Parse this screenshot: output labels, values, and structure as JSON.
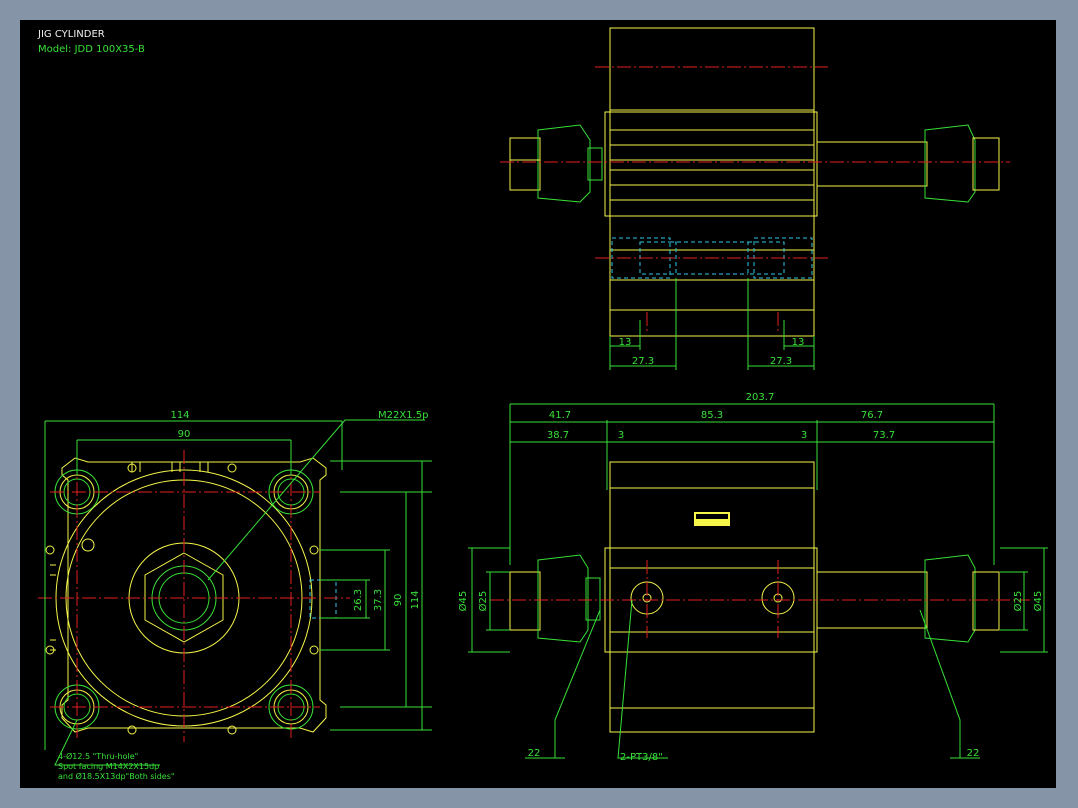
{
  "title": {
    "line1": "JIG CYLINDER",
    "line2": "Model: JDD 100X35-B"
  },
  "colors": {
    "background_outer": "#8694a8",
    "canvas": "#000000",
    "outline": "#f5f54a",
    "dimension": "#38e038",
    "centerline": "#e02020",
    "hidden": "#30c8e8",
    "text": "#f0f0f0"
  },
  "front_view": {
    "dim_width": "114",
    "dim_bolt_pitch": "90",
    "thread_callout": "M22X1.5p",
    "dim_port_26": "26.3",
    "dim_port_37": "37.3",
    "dim_height_90": "90",
    "dim_height_114": "114",
    "hole_note_1": "4-Ø12.5 \"Thru-hole\"",
    "hole_note_2": "Spot facing  M14X2X15dp",
    "hole_note_3": "and Ø18.5X13dp\"Both sides\""
  },
  "top_view": {
    "dim_13_left": "13",
    "dim_13_right": "13",
    "dim_27_left": "27.3",
    "dim_27_right": "27.3"
  },
  "side_view": {
    "dim_total": "203.7",
    "dim_41": "41.7",
    "dim_85": "85.3",
    "dim_76": "76.7",
    "dim_38": "38.7",
    "dim_3_left": "3",
    "dim_3_right": "3",
    "dim_73": "73.7",
    "dim_phi25_left": "Ø25",
    "dim_phi45_left": "Ø45",
    "dim_phi25_right": "Ø25",
    "dim_phi45_right": "Ø45",
    "dim_22_left": "22",
    "dim_22_right": "22",
    "port_callout": "2-PT3/8\""
  }
}
